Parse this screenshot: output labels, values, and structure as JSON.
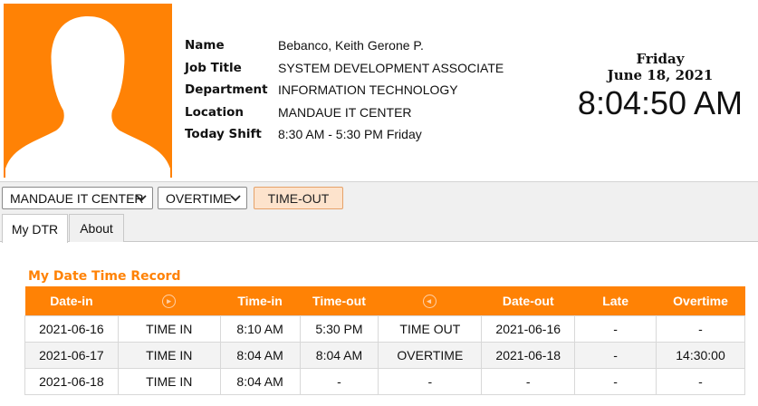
{
  "profile": {
    "fields": [
      {
        "label": "Name",
        "value": "Bebanco, Keith Gerone P."
      },
      {
        "label": "Job Title",
        "value": "SYSTEM DEVELOPMENT ASSOCIATE"
      },
      {
        "label": "Department",
        "value": "INFORMATION TECHNOLOGY"
      },
      {
        "label": "Location",
        "value": "MANDAUE IT CENTER"
      },
      {
        "label": "Today Shift",
        "value": "8:30 AM - 5:30 PM Friday"
      }
    ],
    "avatar_color": "#ff8205"
  },
  "clock": {
    "day": "Friday",
    "date": "June 18, 2021",
    "time": "8:04:50 AM"
  },
  "toolbar": {
    "location_select": "MANDAUE IT CENTER",
    "type_select": "OVERTIME",
    "timeout_button": "TIME-OUT"
  },
  "tabs": [
    {
      "label": "My DTR",
      "active": true
    },
    {
      "label": "About",
      "active": false
    }
  ],
  "dtr": {
    "title": "My Date Time Record",
    "columns": [
      "Date-in",
      "in-icon",
      "Time-in",
      "Time-out",
      "out-icon",
      "Date-out",
      "Late",
      "Overtime"
    ],
    "headers": {
      "date_in": "Date-in",
      "time_in": "Time-in",
      "time_out": "Time-out",
      "date_out": "Date-out",
      "late": "Late",
      "overtime": "Overtime"
    },
    "rows": [
      {
        "date_in": "2021-06-16",
        "in_type": "TIME IN",
        "time_in": "8:10 AM",
        "time_out": "5:30 PM",
        "out_type": "TIME OUT",
        "date_out": "2021-06-16",
        "late": "-",
        "overtime": "-"
      },
      {
        "date_in": "2021-06-17",
        "in_type": "TIME IN",
        "time_in": "8:04 AM",
        "time_out": "8:04 AM",
        "out_type": "OVERTIME",
        "date_out": "2021-06-18",
        "late": "-",
        "overtime": "14:30:00"
      },
      {
        "date_in": "2021-06-18",
        "in_type": "TIME IN",
        "time_in": "8:04 AM",
        "time_out": "-",
        "out_type": "-",
        "date_out": "-",
        "late": "-",
        "overtime": "-"
      }
    ],
    "accent_color": "#ff8205"
  }
}
